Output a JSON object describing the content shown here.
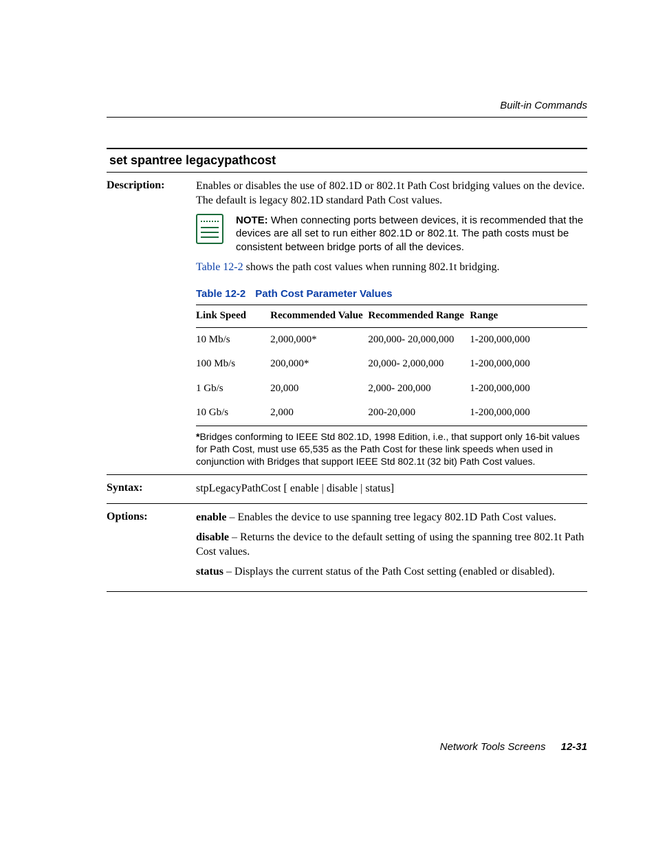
{
  "header": {
    "running": "Built-in Commands"
  },
  "section": {
    "title": "set spantree legacypathcost"
  },
  "labels": {
    "description": "Description:",
    "syntax": "Syntax:",
    "options": "Options:"
  },
  "description": {
    "text": "Enables or disables the use of 802.1D or 802.1t Path Cost bridging values on the device. The default is legacy 802.1D standard Path Cost values."
  },
  "note": {
    "label": "NOTE:",
    "text": "  When connecting ports between devices, it is recommended that the devices are all set to run either 802.1D or 802.1t. The path costs must be consistent between bridge ports of all the devices."
  },
  "table_ref": {
    "link": "Table 12-2",
    "rest": " shows the path cost values when running 802.1t bridging."
  },
  "table": {
    "caption_num": "Table 12-2",
    "caption_title": "Path Cost Parameter Values",
    "headers": [
      "Link Speed",
      "Recommended Value",
      "Recommended Range",
      "Range"
    ],
    "rows": [
      {
        "link": "10 Mb/s",
        "recv": "2,000,000*",
        "recr": "200,000- 20,000,000",
        "range": "1-200,000,000"
      },
      {
        "link": "100 Mb/s",
        "recv": "200,000*",
        "recr": "20,000- 2,000,000",
        "range": "1-200,000,000"
      },
      {
        "link": "1 Gb/s",
        "recv": "20,000",
        "recr": "2,000- 200,000",
        "range": "1-200,000,000"
      },
      {
        "link": "10 Gb/s",
        "recv": "2,000",
        "recr": "200-20,000",
        "range": "1-200,000,000"
      }
    ],
    "footnote_star": "*",
    "footnote": "Bridges conforming to IEEE Std 802.1D, 1998 Edition, i.e., that support only 16-bit values for Path Cost, must use 65,535 as the Path Cost for these link speeds when used in conjunction with Bridges that support IEEE Std 802.1t (32 bit) Path Cost values."
  },
  "syntax": {
    "text": "stpLegacyPathCost [ enable | disable | status]"
  },
  "options": {
    "enable_kw": "enable",
    "enable_text": " – Enables the device to use spanning tree legacy 802.1D Path Cost values.",
    "disable_kw": "disable",
    "disable_text": " – Returns the device to the default setting of using the spanning tree 802.1t Path Cost values.",
    "status_kw": "status",
    "status_text": " – Displays the current status of the Path Cost setting (enabled or disabled)."
  },
  "footer": {
    "title": "Network Tools Screens",
    "page": "12-31"
  },
  "chart_data": {
    "type": "table",
    "title": "Path Cost Parameter Values",
    "columns": [
      "Link Speed",
      "Recommended Value",
      "Recommended Range",
      "Range"
    ],
    "rows": [
      [
        "10 Mb/s",
        "2,000,000*",
        "200,000-20,000,000",
        "1-200,000,000"
      ],
      [
        "100 Mb/s",
        "200,000*",
        "20,000-2,000,000",
        "1-200,000,000"
      ],
      [
        "1 Gb/s",
        "20,000",
        "2,000-200,000",
        "1-200,000,000"
      ],
      [
        "10 Gb/s",
        "2,000",
        "200-20,000",
        "1-200,000,000"
      ]
    ]
  }
}
